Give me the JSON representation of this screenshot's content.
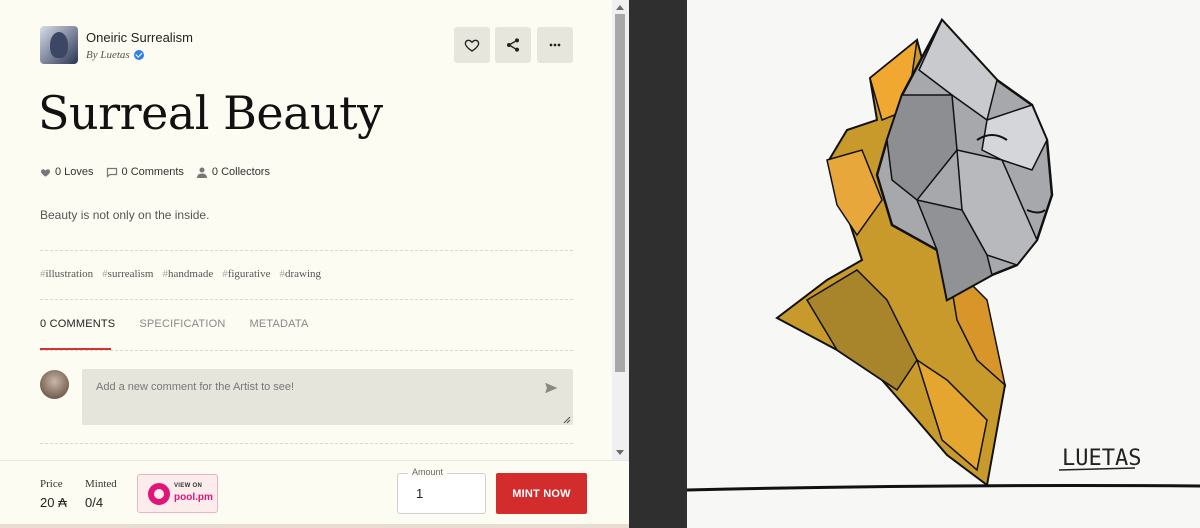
{
  "collection": {
    "name": "Oneiric Surrealism",
    "by": "By Luetas"
  },
  "artwork": {
    "title": "Surreal Beauty",
    "description": "Beauty is not only on the inside.",
    "signature": "LUETAS"
  },
  "stats": {
    "loves": "0 Loves",
    "comments": "0 Comments",
    "collectors": "0 Collectors"
  },
  "tags": [
    "illustration",
    "surrealism",
    "handmade",
    "figurative",
    "drawing"
  ],
  "tabs": [
    "0 COMMENTS",
    "SPECIFICATION",
    "METADATA"
  ],
  "comment": {
    "placeholder": "Add a new comment for the Artist to see!"
  },
  "purchase": {
    "price_label": "Price",
    "price_value": "20 ₳",
    "minted_label": "Minted",
    "minted_value": "0/4",
    "pool_view": "VIEW ON",
    "pool_name": "pool.pm",
    "amount_label": "Amount",
    "amount_value": "1",
    "mint_label": "MINT NOW"
  },
  "icons": {
    "favorite": "heart-icon",
    "share": "share-icon",
    "more": "more-horizontal-icon",
    "send": "send-icon"
  },
  "colors": {
    "accent": "#d32c2c",
    "background": "#fdfcf2",
    "pool_brand": "#e0157a"
  }
}
